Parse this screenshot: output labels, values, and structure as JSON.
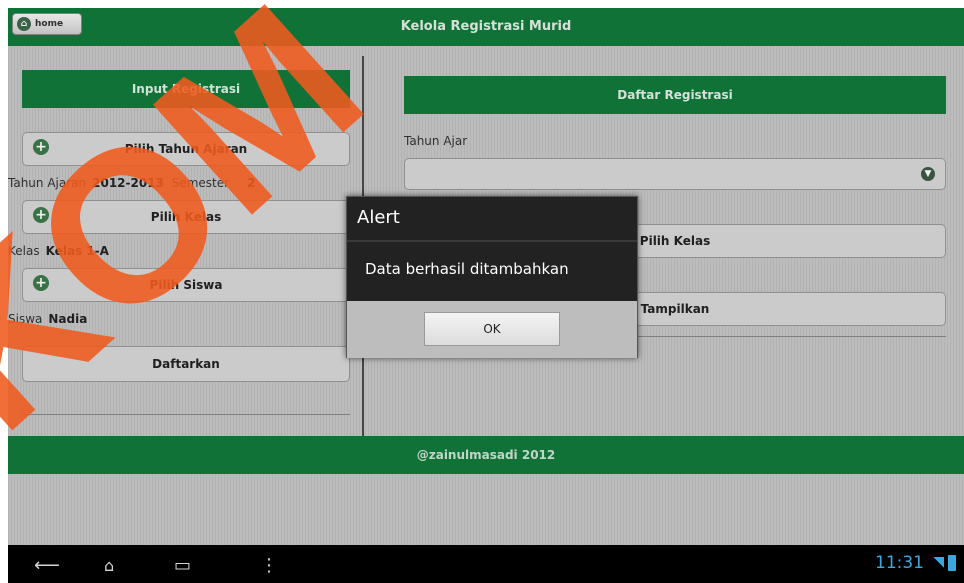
{
  "header": {
    "title": "Kelola Registrasi Murid",
    "home_label": "home"
  },
  "left": {
    "section_title": "Input Registrasi",
    "btn_tahun": "Pilih Tahun Ajaran",
    "tahun_label": "Tahun Ajaran",
    "tahun_value": "2012-2013",
    "semester_label": "Semester",
    "semester_value": "2",
    "btn_kelas": "Pilih Kelas",
    "kelas_label": "Kelas",
    "kelas_value": "Kelas 1-A",
    "btn_siswa": "Pilih Siswa",
    "siswa_label": "Siswa",
    "siswa_value": "Nadia",
    "btn_daftar": "Daftarkan"
  },
  "right": {
    "section_title": "Daftar Registrasi",
    "tahun_label": "Tahun Ajar",
    "select_value": "",
    "btn_kelas": "Pilih Kelas",
    "btn_tampilkan": "Tampilkan"
  },
  "footer": {
    "text": "@zainulmasadi 2012"
  },
  "dialog": {
    "title": "Alert",
    "message": "Data berhasil ditambahkan",
    "ok_label": "OK"
  },
  "statusbar": {
    "time": "11:31"
  },
  "watermark": {
    "text": "KOM"
  },
  "colors": {
    "brand_green": "#137a3c",
    "accent_blue": "#3aa9e0"
  }
}
